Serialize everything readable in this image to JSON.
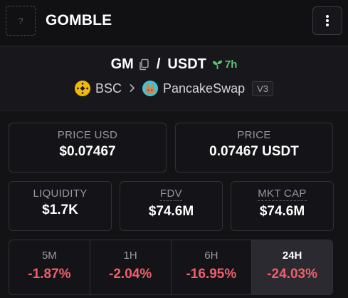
{
  "header": {
    "logo_placeholder": "?",
    "token_name": "GOMBLE",
    "menu_icon": "more-vertical-icon"
  },
  "pair": {
    "base": "GM",
    "separator": "/",
    "quote": "USDT",
    "age": "7h",
    "chain": "BSC",
    "dex": "PancakeSwap",
    "version": "V3"
  },
  "stats": {
    "price_usd": {
      "label": "PRICE USD",
      "value": "$0.07467"
    },
    "price": {
      "label": "PRICE",
      "value": "0.07467 USDT"
    },
    "liquidity": {
      "label": "LIQUIDITY",
      "value": "$1.7K"
    },
    "fdv": {
      "label": "FDV",
      "value": "$74.6M"
    },
    "mkt_cap": {
      "label": "MKT CAP",
      "value": "$74.6M"
    }
  },
  "changes": [
    {
      "period": "5M",
      "value": "-1.87%"
    },
    {
      "period": "1H",
      "value": "-2.04%"
    },
    {
      "period": "6H",
      "value": "-16.95%"
    },
    {
      "period": "24H",
      "value": "-24.03%",
      "selected": true
    }
  ],
  "colors": {
    "background": "#131316",
    "negative": "#f05f6b",
    "age_green": "#57c773",
    "bsc_yellow": "#f0b90b"
  }
}
